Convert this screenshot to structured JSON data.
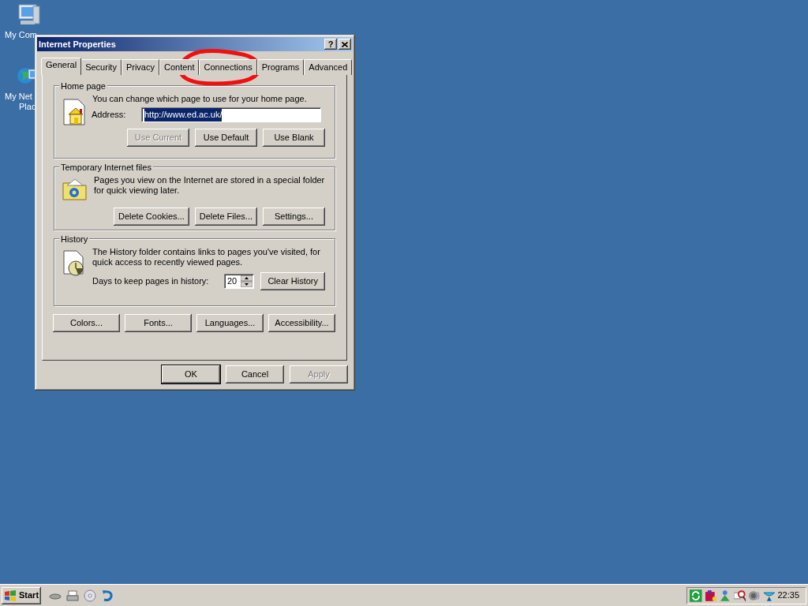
{
  "desktop_icons": [
    {
      "kind": "computer",
      "label_lines": [
        "My Com"
      ]
    },
    {
      "kind": "network",
      "label_lines": [
        "My Net",
        "Plac"
      ]
    }
  ],
  "dialog": {
    "title": "Internet Properties",
    "help_button": "?",
    "tabs": [
      {
        "label": "General",
        "selected": true
      },
      {
        "label": "Security",
        "selected": false
      },
      {
        "label": "Privacy",
        "selected": false
      },
      {
        "label": "Content",
        "selected": false
      },
      {
        "label": "Connections",
        "selected": false
      },
      {
        "label": "Programs",
        "selected": false
      },
      {
        "label": "Advanced",
        "selected": false
      }
    ],
    "home_page": {
      "legend": "Home page",
      "description": "You can change which page to use for your home page.",
      "address_label": "Address:",
      "address_value": "http://www.ed.ac.uk/",
      "address_selected": true,
      "buttons": [
        {
          "label": "Use Current",
          "disabled": true
        },
        {
          "label": "Use Default",
          "disabled": false
        },
        {
          "label": "Use Blank",
          "disabled": false
        }
      ]
    },
    "temporary_files": {
      "legend": "Temporary Internet files",
      "description": "Pages you view on the Internet are stored in a special folder for quick viewing later.",
      "buttons": [
        {
          "label": "Delete Cookies...",
          "disabled": false
        },
        {
          "label": "Delete Files...",
          "disabled": false
        },
        {
          "label": "Settings...",
          "disabled": false
        }
      ]
    },
    "history": {
      "legend": "History",
      "description": "The History folder contains links to pages you've visited, for quick access to recently viewed pages.",
      "days_label": "Days to keep pages in history:",
      "days_value": "20",
      "buttons": [
        {
          "label": "Clear History",
          "disabled": false
        }
      ]
    },
    "bottom_buttons": [
      {
        "label": "Colors...",
        "disabled": false
      },
      {
        "label": "Fonts...",
        "disabled": false
      },
      {
        "label": "Languages...",
        "disabled": false
      },
      {
        "label": "Accessibility...",
        "disabled": false
      }
    ],
    "dialog_buttons": [
      {
        "label": "OK",
        "default": true,
        "disabled": false
      },
      {
        "label": "Cancel",
        "default": false,
        "disabled": false
      },
      {
        "label": "Apply",
        "default": false,
        "disabled": true
      }
    ]
  },
  "annotation": {
    "kind": "ellipse"
  },
  "taskbar": {
    "start_label": "Start",
    "clock": "22:35"
  }
}
